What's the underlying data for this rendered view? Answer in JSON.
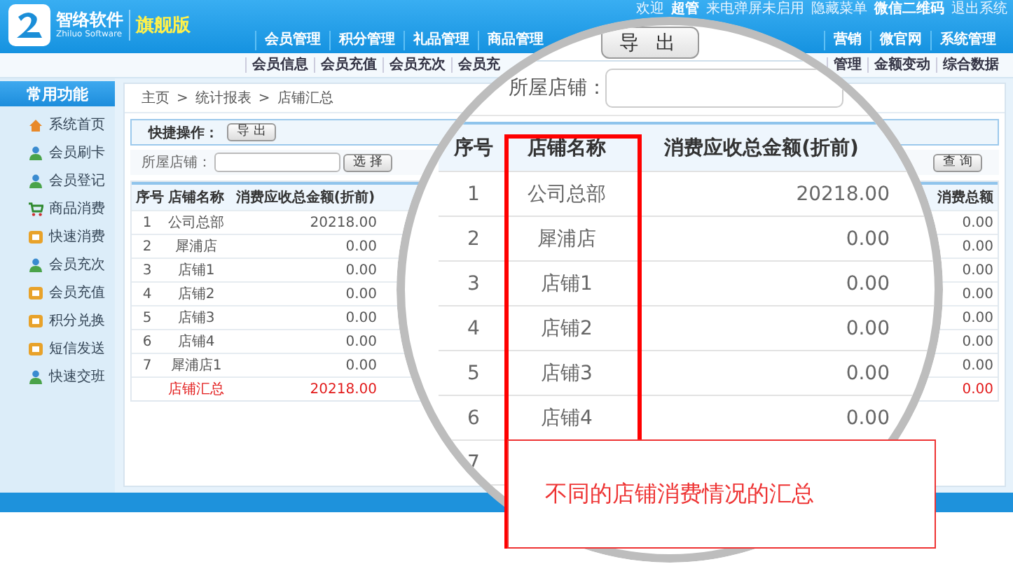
{
  "header": {
    "brand": "智络软件",
    "brand_sub": "Zhiluo Software",
    "edition": "旗舰版",
    "top_links": [
      {
        "text": "欢迎",
        "bold": false
      },
      {
        "text": "超管",
        "bold": true
      },
      {
        "text": "来电弹屏未启用",
        "bold": false
      },
      {
        "text": "隐藏菜单",
        "bold": false
      },
      {
        "text": "微信二维码",
        "bold": true
      },
      {
        "text": "退出系统",
        "bold": false
      }
    ],
    "nav_left": [
      "会员管理",
      "积分管理",
      "礼品管理",
      "商品管理"
    ],
    "nav_right": [
      "营销",
      "微官网",
      "系统管理"
    ],
    "subnav_left": [
      "会员信息",
      "会员充值",
      "会员充次",
      "会员充"
    ],
    "subnav_right": [
      "管理",
      "金额变动",
      "综合数据"
    ]
  },
  "sidebar": {
    "title": "常用功能",
    "items": [
      "系统首页",
      "会员刷卡",
      "会员登记",
      "商品消费",
      "快速消费",
      "会员充次",
      "会员充值",
      "积分兑换",
      "短信发送",
      "快速交班"
    ]
  },
  "breadcrumb": {
    "items": [
      "主页",
      "统计报表",
      "店铺汇总"
    ],
    "separator": ">"
  },
  "quick_ops": {
    "label": "快捷操作：",
    "button": "导 出"
  },
  "filter": {
    "label": "所屋店铺：",
    "select_button": "选 择",
    "query_button": "查 询"
  },
  "table": {
    "columns": [
      "序号",
      "店铺名称",
      "消费应收总金额(折前)",
      "消费总额"
    ],
    "rows": [
      {
        "kind": "normal",
        "no": "1",
        "name": "公司总部",
        "amount": "20218.00",
        "total": "0.00"
      },
      {
        "kind": "normal",
        "no": "2",
        "name": "犀浦店",
        "amount": "0.00",
        "total": "0.00"
      },
      {
        "kind": "normal",
        "no": "3",
        "name": "店铺1",
        "amount": "0.00",
        "total": "0.00"
      },
      {
        "kind": "normal",
        "no": "4",
        "name": "店铺2",
        "amount": "0.00",
        "total": "0.00"
      },
      {
        "kind": "normal",
        "no": "5",
        "name": "店铺3",
        "amount": "0.00",
        "total": "0.00"
      },
      {
        "kind": "normal",
        "no": "6",
        "name": "店铺4",
        "amount": "0.00",
        "total": "0.00"
      },
      {
        "kind": "normal",
        "no": "7",
        "name": "犀浦店1",
        "amount": "0.00",
        "total": "0.00"
      },
      {
        "kind": "summary",
        "no": "",
        "name": "店铺汇总",
        "amount": "20218.00",
        "total": "0.00"
      }
    ]
  },
  "magnifier": {
    "export_button": "导 出",
    "filter_label": "所屋店铺：",
    "columns": [
      "序号",
      "店铺名称",
      "消费应收总金额(折前)"
    ],
    "rows": [
      {
        "no": "1",
        "name": "公司总部",
        "amount": "20218.00"
      },
      {
        "no": "2",
        "name": "犀浦店",
        "amount": "0.00"
      },
      {
        "no": "3",
        "name": "店铺1",
        "amount": "0.00"
      },
      {
        "no": "4",
        "name": "店铺2",
        "amount": "0.00"
      },
      {
        "no": "5",
        "name": "店铺3",
        "amount": "0.00"
      },
      {
        "no": "6",
        "name": "店铺4",
        "amount": "0.00"
      },
      {
        "no": "7",
        "name": "",
        "amount": ""
      }
    ]
  },
  "callout": {
    "text": "不同的店铺消费情况的汇总"
  }
}
